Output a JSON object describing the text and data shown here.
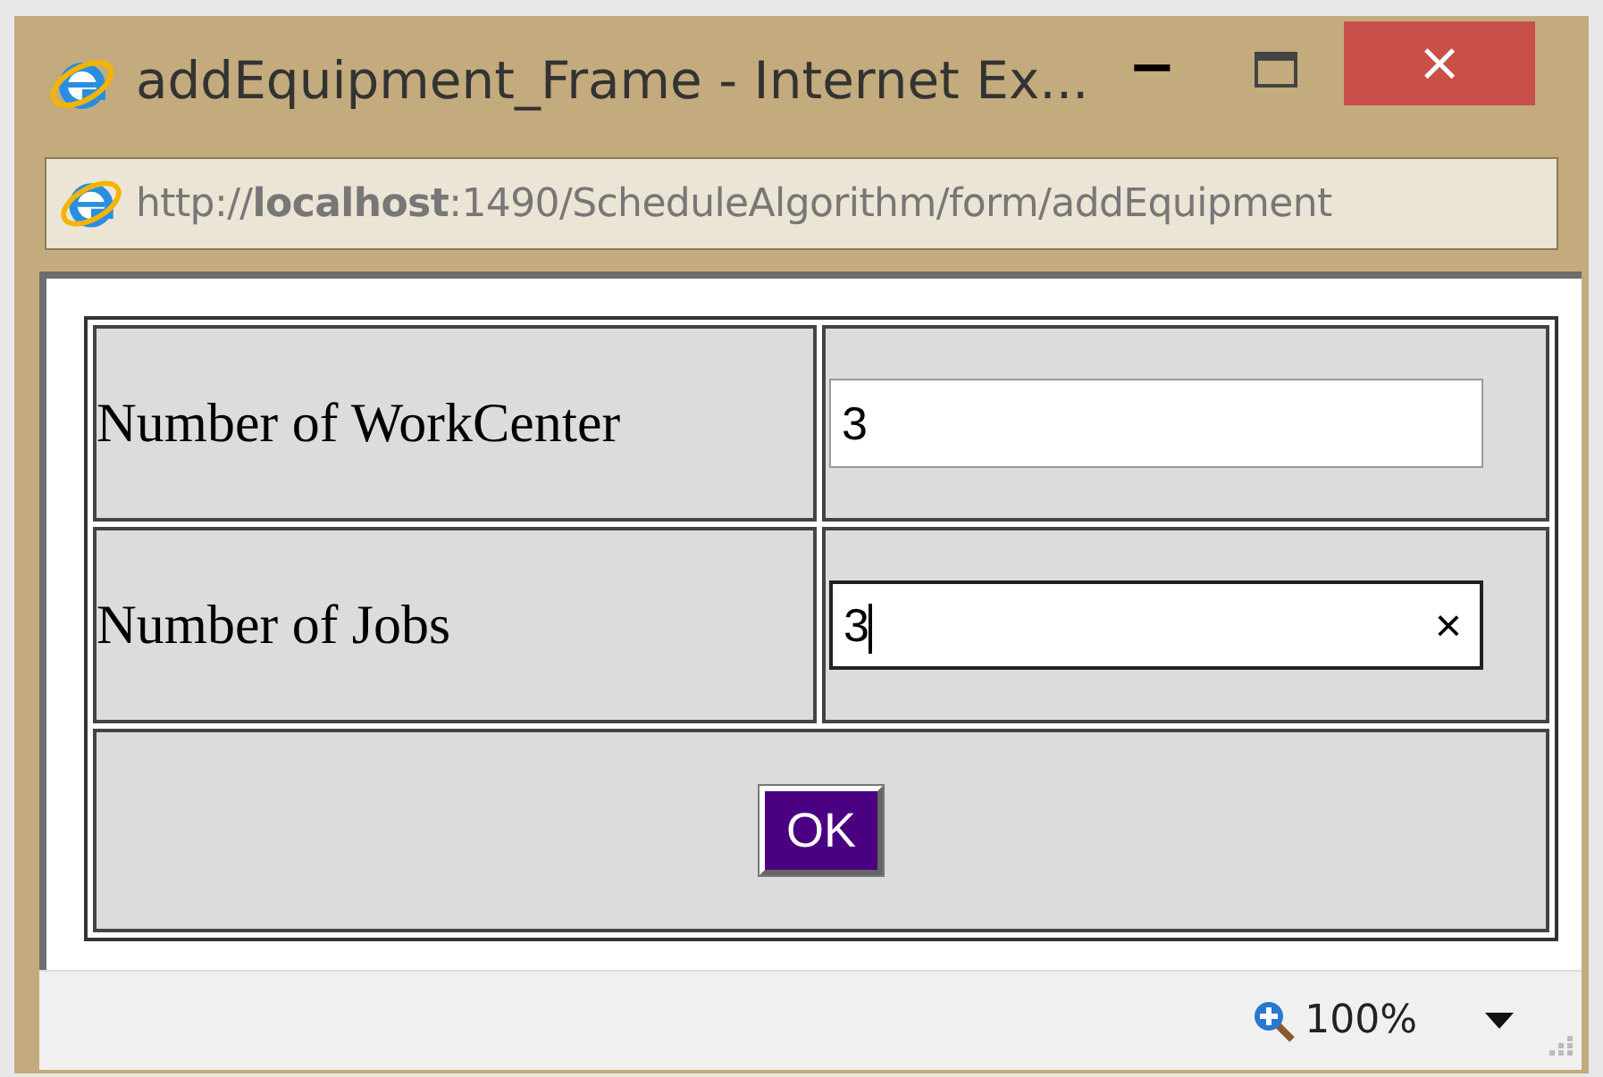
{
  "window": {
    "title": "addEquipment_Frame - Internet Ex...",
    "controls": {
      "minimize": "−",
      "close": "×"
    }
  },
  "address_bar": {
    "url": "http://**localhost**:1490/ScheduleAlgorithm/form/addEquipment"
  },
  "form": {
    "rows": [
      {
        "label": "Number of WorkCenter",
        "value": "3",
        "focused": false
      },
      {
        "label": "Number of Jobs",
        "value": "3",
        "focused": true,
        "clear": "×"
      }
    ],
    "button": "OK"
  },
  "status_bar": {
    "zoom": "100%"
  }
}
